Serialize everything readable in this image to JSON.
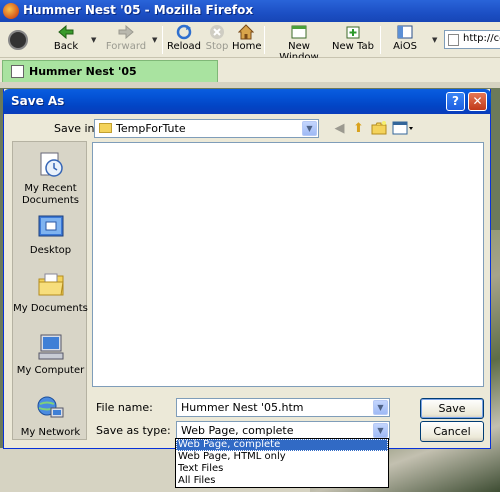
{
  "browser": {
    "window_title": "Hummer Nest '05 - Mozilla Firefox",
    "toolbar": {
      "back_label": "Back",
      "forward_label": "Forward",
      "reload_label": "Reload",
      "stop_label": "Stop",
      "home_label": "Home",
      "new_window_label": "New Window",
      "new_tab_label": "New Tab",
      "aios_label": "AiOS"
    },
    "url_value": "http://co",
    "tab_label": "Hummer Nest '05"
  },
  "dialog": {
    "title": "Save As",
    "help_glyph": "?",
    "close_glyph": "✕",
    "save_in_label": "Save in:",
    "save_in_value": "TempForTute",
    "places": [
      {
        "label": "My Recent Documents",
        "icon": "recent-documents-icon"
      },
      {
        "label": "Desktop",
        "icon": "desktop-icon"
      },
      {
        "label": "My Documents",
        "icon": "my-documents-icon"
      },
      {
        "label": "My Computer",
        "icon": "my-computer-icon"
      },
      {
        "label": "My Network",
        "icon": "my-network-icon"
      }
    ],
    "file_name_label": "File name:",
    "file_name_value": "Hummer Nest '05.htm",
    "save_as_type_label": "Save as type:",
    "save_as_type_value": "Web Page, complete",
    "type_options": [
      "Web Page, complete",
      "Web Page, HTML only",
      "Text Files",
      "All Files"
    ],
    "selected_type_index": 0,
    "save_button_label": "Save",
    "cancel_button_label": "Cancel"
  }
}
